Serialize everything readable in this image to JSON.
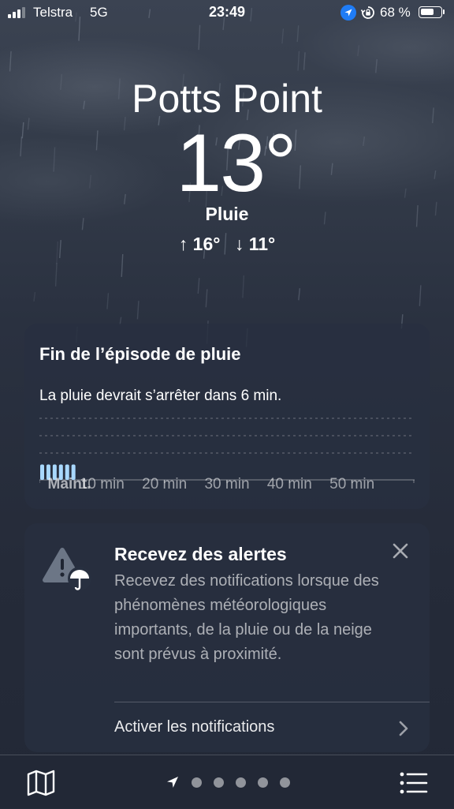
{
  "status_bar": {
    "carrier": "Telstra",
    "network": "5G",
    "time": "23:49",
    "battery_text": "68 %",
    "battery_level": 0.68,
    "icons": [
      "signal-icon",
      "location-arrow-icon",
      "rotation-lock-icon",
      "battery-icon"
    ]
  },
  "location": {
    "city": "Potts Point",
    "temperature": "13°",
    "condition": "Pluie",
    "high": "↑ 16°",
    "low": "↓ 11°"
  },
  "rain_card": {
    "title": "Fin de l’épisode de pluie",
    "subtitle": "La pluie devrait s’arrêter dans 6 min.",
    "chart_data": {
      "type": "bar",
      "x_labels": [
        "Maint.",
        "10 min",
        "20 min",
        "30 min",
        "40 min",
        "50 min"
      ],
      "x_range_min": [
        0,
        60
      ],
      "minutes_with_rain": [
        0,
        1,
        2,
        3,
        4,
        5
      ],
      "rain_intensity": [
        0.25,
        0.25,
        0.25,
        0.25,
        0.25,
        0.25
      ],
      "bar_color": "#a8d8ff",
      "grid": true
    }
  },
  "alert_card": {
    "title": "Recevez des alertes",
    "body": "Recevez des notifications lorsque des phénomènes météorologiques importants, de la pluie ou de la neige sont prévus à proximité.",
    "action": "Activer les notifications",
    "icons": [
      "warning-umbrella-icon",
      "close-icon",
      "chevron-right-icon"
    ]
  },
  "bottom_bar": {
    "icons": [
      "map-icon",
      "location-arrow-icon",
      "list-icon"
    ],
    "page_dots": 5,
    "current_page": 0
  },
  "colors": {
    "background": "#2a3140",
    "card": "#283040",
    "location_badge": "#1f7cf6",
    "rain_bar": "#a8d8ff"
  }
}
